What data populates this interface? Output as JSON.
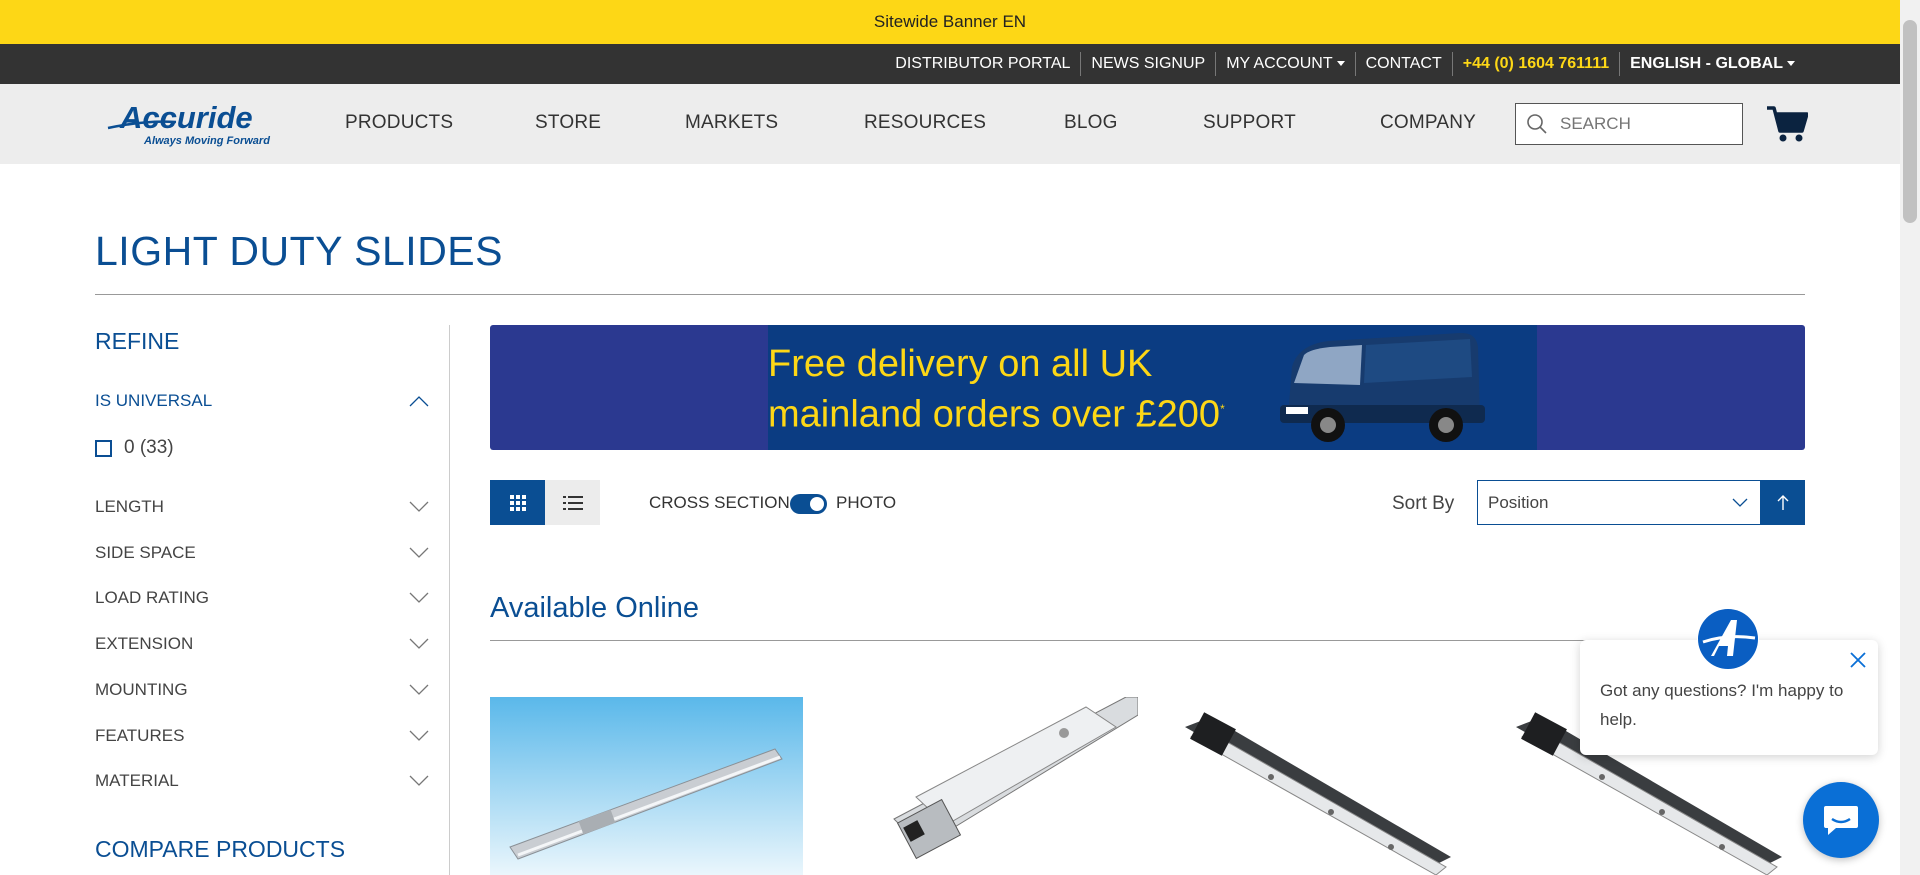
{
  "banner": {
    "text": "Sitewide Banner EN"
  },
  "utility_nav": {
    "items": [
      "DISTRIBUTOR PORTAL",
      "NEWS SIGNUP",
      "MY ACCOUNT",
      "CONTACT",
      "+44 (0) 1604 761111",
      "ENGLISH - GLOBAL"
    ]
  },
  "logo": {
    "brand": "Accuride",
    "tagline": "Always Moving Forward"
  },
  "main_nav": {
    "items": [
      "PRODUCTS",
      "STORE",
      "MARKETS",
      "RESOURCES",
      "BLOG",
      "SUPPORT",
      "COMPANY"
    ]
  },
  "search": {
    "placeholder": "SEARCH"
  },
  "page": {
    "title": "LIGHT DUTY SLIDES"
  },
  "sidebar": {
    "refine_heading": "REFINE",
    "filters": [
      {
        "label": "IS UNIVERSAL",
        "expanded": true
      },
      {
        "label": "LENGTH",
        "expanded": false
      },
      {
        "label": "SIDE SPACE",
        "expanded": false
      },
      {
        "label": "LOAD RATING",
        "expanded": false
      },
      {
        "label": "EXTENSION",
        "expanded": false
      },
      {
        "label": "MOUNTING",
        "expanded": false
      },
      {
        "label": "FEATURES",
        "expanded": false
      },
      {
        "label": "MATERIAL",
        "expanded": false
      }
    ],
    "universal_option": {
      "label": "0 (33)",
      "checked": false
    },
    "compare_heading": "COMPARE PRODUCTS"
  },
  "promo": {
    "line1": "Free delivery on all UK",
    "line2": "mainland orders over £200",
    "mark": "*",
    "colors": {
      "bg": "#2b3990",
      "text": "#fdd716"
    }
  },
  "toolbar": {
    "cross_section_label": "CROSS SECTION",
    "photo_label": "PHOTO",
    "toggle_on": true,
    "sort_by_label": "Sort By",
    "sort_value": "Position",
    "view_mode": "grid"
  },
  "section": {
    "title": "Available Online"
  },
  "chat": {
    "message": "Got any questions? I'm happy to help."
  },
  "colors": {
    "brand_blue": "#0a4e93",
    "banner_yellow": "#fdd716",
    "utility_bar": "#333333",
    "nav_bg": "#ededed"
  }
}
